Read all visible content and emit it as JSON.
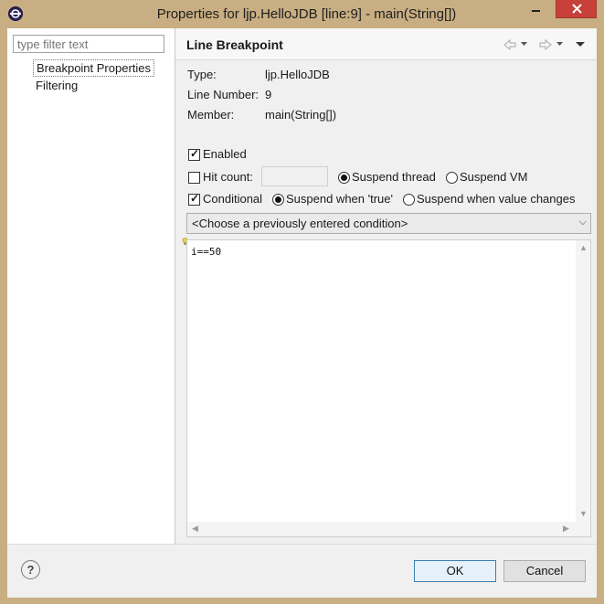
{
  "window": {
    "title": "Properties for ljp.HelloJDB [line:9] - main(String[])",
    "controls": {
      "minimize": "minimize-icon",
      "maximize": "maximize-icon",
      "close": "close-icon"
    },
    "close_color": "#c7403a"
  },
  "sidebar": {
    "filter_placeholder": "type filter text",
    "items": [
      {
        "label": "Breakpoint Properties",
        "selected": true
      },
      {
        "label": "Filtering",
        "selected": false
      }
    ]
  },
  "page": {
    "title": "Line Breakpoint",
    "nav_icons": [
      "back-arrow-icon",
      "dropdown-icon",
      "forward-arrow-icon",
      "dropdown-icon",
      "view-menu-icon"
    ]
  },
  "info": {
    "type_label": "Type:",
    "type_value": "ljp.HelloJDB",
    "line_label": "Line Number:",
    "line_value": "9",
    "member_label": "Member:",
    "member_value": "main(String[])"
  },
  "options": {
    "enabled": {
      "label": "Enabled",
      "checked": true
    },
    "hit_count": {
      "label": "Hit count:",
      "checked": false,
      "value": ""
    },
    "suspend_thread": {
      "label": "Suspend thread",
      "selected": true
    },
    "suspend_vm": {
      "label": "Suspend VM",
      "selected": false
    },
    "conditional": {
      "label": "Conditional",
      "checked": true
    },
    "suspend_when_true": {
      "label": "Suspend when 'true'",
      "selected": true
    },
    "suspend_when_changes": {
      "label": "Suspend when value changes",
      "selected": false
    }
  },
  "condition": {
    "history_placeholder": "<Choose a previously entered condition>",
    "text": "i==50"
  },
  "footer": {
    "ok_label": "OK",
    "cancel_label": "Cancel",
    "help_icon": "help-icon"
  }
}
